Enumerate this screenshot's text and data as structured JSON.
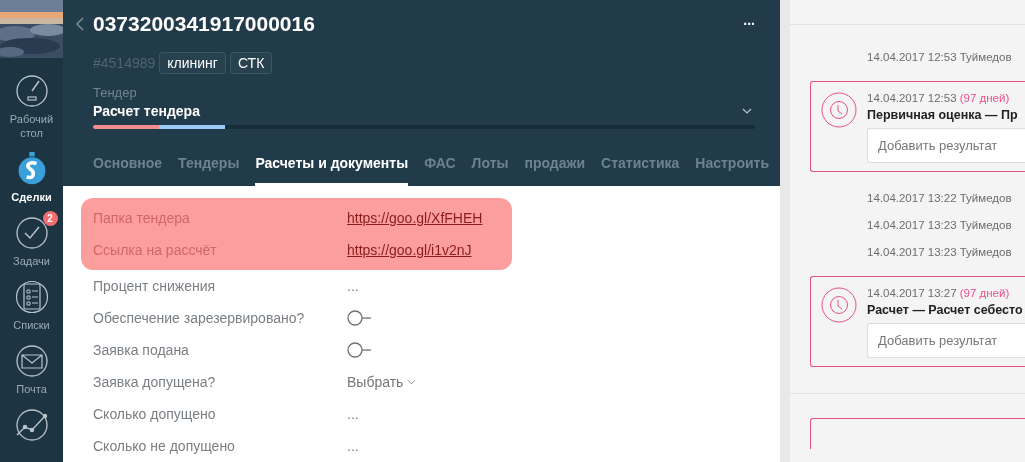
{
  "nav": {
    "items": [
      {
        "label": "Рабочий стол",
        "selected": false
      },
      {
        "label": "Сделки",
        "selected": true
      },
      {
        "label": "Задачи",
        "selected": false,
        "badge": "2"
      },
      {
        "label": "Списки",
        "selected": false
      },
      {
        "label": "Почта",
        "selected": false
      },
      {
        "selected": false
      }
    ]
  },
  "header": {
    "title": "0373200341917000016",
    "more": "...",
    "id": "#4514989",
    "tags": [
      "клининг",
      "СТК"
    ],
    "pipeline_label": "Тендер",
    "stage": "Расчет тендера",
    "progress": {
      "level": 0.2,
      "segments": [
        {
          "color": "#f28b8b"
        },
        {
          "color": "#99c9f5"
        }
      ]
    }
  },
  "tabs": [
    {
      "label": "Основное",
      "selected": false
    },
    {
      "label": "Тендеры",
      "selected": false
    },
    {
      "label": "Расчеты и документы",
      "selected": true
    },
    {
      "label": "ФАС",
      "selected": false
    },
    {
      "label": "Лоты",
      "selected": false
    },
    {
      "label": "продажи",
      "selected": false
    },
    {
      "label": "Статистика",
      "selected": false
    },
    {
      "label": "Настроить",
      "selected": false
    }
  ],
  "fields": [
    {
      "label": "Папка тендера",
      "kind": "link",
      "value": "https://goo.gl/XfFHEH",
      "highlighted": true
    },
    {
      "label": "Ссылка на рассчёт",
      "kind": "link",
      "value": "https://goo.gl/i1v2nJ",
      "highlighted": true
    },
    {
      "label": "Процент снижения",
      "kind": "text",
      "value": "...",
      "highlighted": false
    },
    {
      "label": "Обеспечение зарезервировано?",
      "kind": "toggle",
      "on": false,
      "highlighted": false
    },
    {
      "label": "Заявка подана",
      "kind": "toggle",
      "on": false,
      "highlighted": false
    },
    {
      "label": "Заявка допущена?",
      "kind": "select",
      "value": "Выбрать",
      "highlighted": false
    },
    {
      "label": "Сколько допущено",
      "kind": "text",
      "value": "...",
      "highlighted": false
    },
    {
      "label": "Сколько не допущено",
      "kind": "text",
      "value": "...",
      "highlighted": false
    }
  ],
  "feed": [
    {
      "kind": "note",
      "text": "14.04.2017 12:53 Туймедов"
    },
    {
      "kind": "task",
      "time": "14.04.2017 12:53",
      "days": "(97 дней)",
      "title": "Первичная оценка — Пр",
      "placeholder": "Добавить результат"
    },
    {
      "kind": "note",
      "text": "14.04.2017 13:22 Туймедов"
    },
    {
      "kind": "note",
      "text": "14.04.2017 13:23 Туймедов"
    },
    {
      "kind": "note",
      "text": "14.04.2017 13:23 Туймедов"
    },
    {
      "kind": "task",
      "time": "14.04.2017 13:27",
      "days": "(97 дней)",
      "title": "Расчет — Расчет себесто",
      "placeholder": "Добавить результат"
    },
    {
      "kind": "divider"
    },
    {
      "kind": "task_stub"
    }
  ]
}
